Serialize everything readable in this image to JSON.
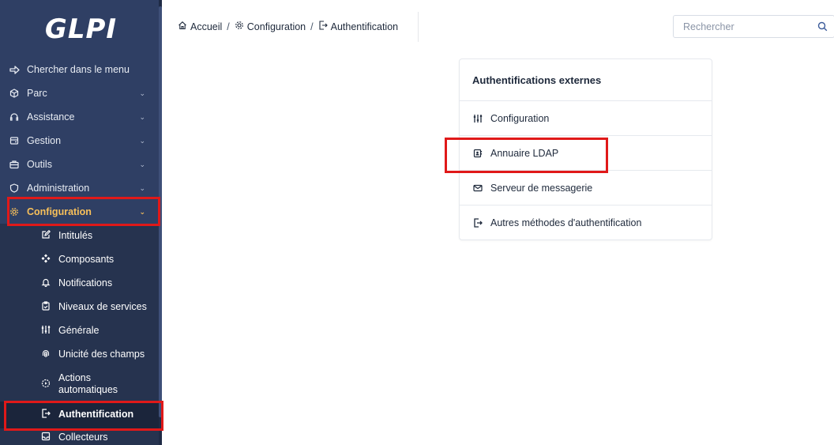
{
  "app": {
    "logo": "GLPI"
  },
  "sidebar": {
    "items": [
      {
        "icon": "arrow-right-icon",
        "label": "Chercher dans le menu"
      },
      {
        "icon": "box-icon",
        "label": "Parc"
      },
      {
        "icon": "headset-icon",
        "label": "Assistance"
      },
      {
        "icon": "wallet-icon",
        "label": "Gestion"
      },
      {
        "icon": "briefcase-icon",
        "label": "Outils"
      },
      {
        "icon": "shield-icon",
        "label": "Administration"
      },
      {
        "icon": "gear-icon",
        "label": "Configuration"
      }
    ],
    "sub_items": [
      {
        "icon": "edit-icon",
        "label": "Intitulés"
      },
      {
        "icon": "components-icon",
        "label": "Composants"
      },
      {
        "icon": "bell-icon",
        "label": "Notifications"
      },
      {
        "icon": "clipboard-icon",
        "label": "Niveaux de services"
      },
      {
        "icon": "sliders-icon",
        "label": "Générale"
      },
      {
        "icon": "fingerprint-icon",
        "label": "Unicité des champs"
      },
      {
        "icon": "cog-play-icon",
        "label": "Actions automatiques"
      },
      {
        "icon": "login-icon",
        "label": "Authentification"
      },
      {
        "icon": "inbox-icon",
        "label": "Collecteurs"
      }
    ]
  },
  "breadcrumb": {
    "items": [
      "Accueil",
      "Configuration",
      "Authentification"
    ],
    "separator": "/"
  },
  "search": {
    "placeholder": "Rechercher"
  },
  "card": {
    "title": "Authentifications externes",
    "rows": [
      {
        "icon": "sliders-icon",
        "label": "Configuration"
      },
      {
        "icon": "address-book-icon",
        "label": "Annuaire LDAP"
      },
      {
        "icon": "mail-icon",
        "label": "Serveur de messagerie"
      },
      {
        "icon": "login-icon",
        "label": "Autres méthodes d'authentification"
      }
    ]
  },
  "colors": {
    "sidebar": "#2f3f64",
    "submenu": "#26334f",
    "active": "#f8c05a",
    "highlight": "#e01919"
  }
}
